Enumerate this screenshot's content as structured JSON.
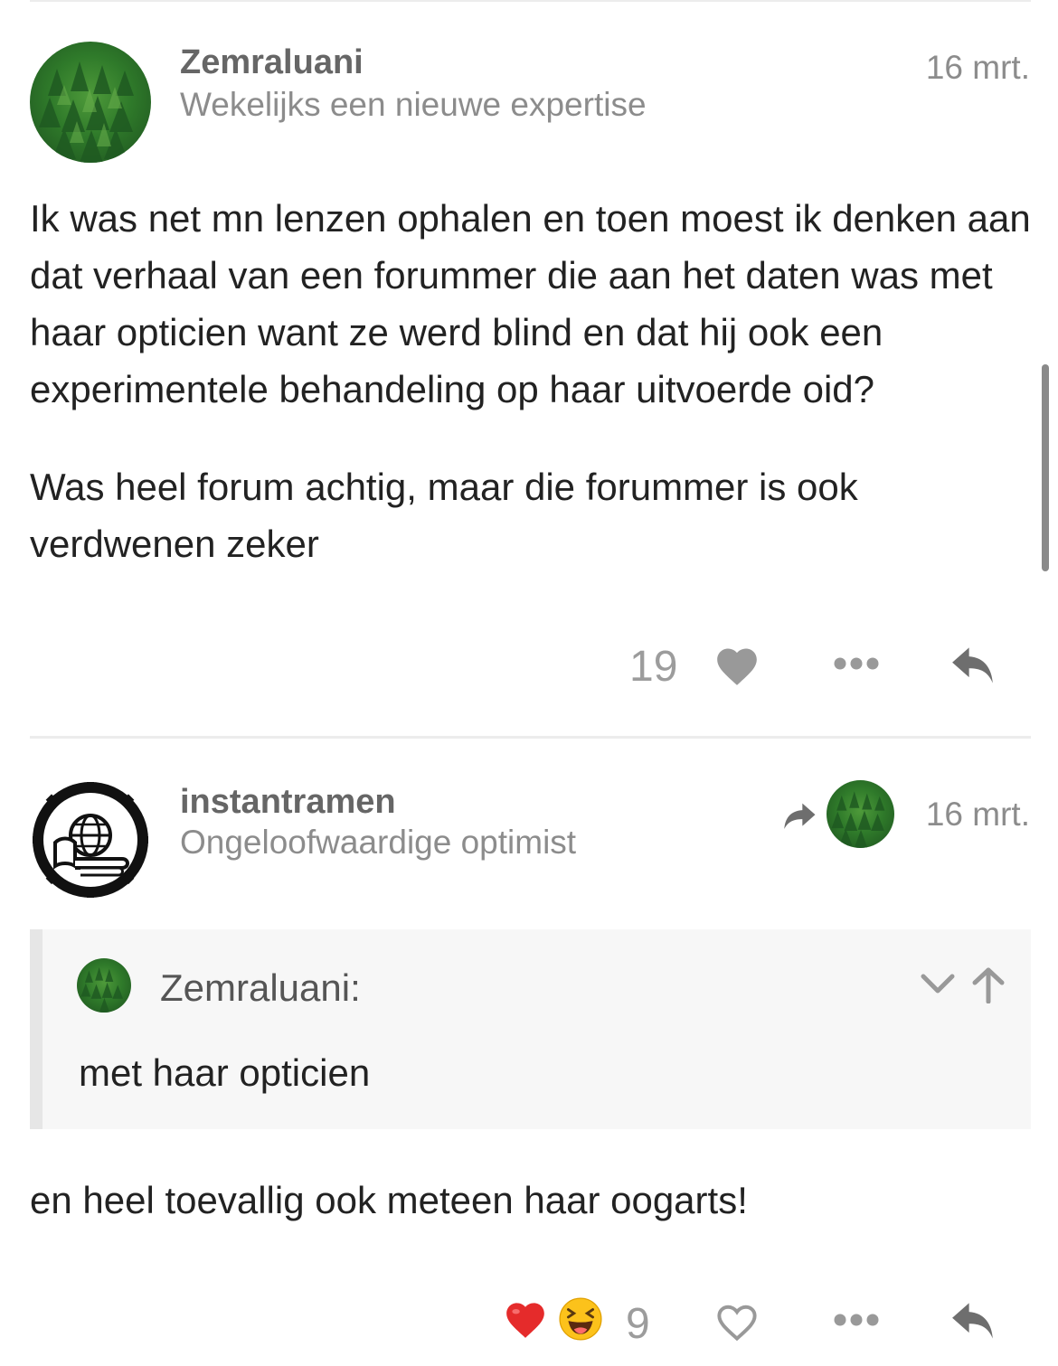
{
  "posts": [
    {
      "username": "Zemraluani",
      "user_title": "Wekelijks een nieuwe expertise",
      "date": "16 mrt.",
      "body": [
        "Ik was net mn lenzen ophalen en toen moest ik denken aan dat verhaal van een forummer die aan het daten was met haar opticien want ze werd blind en dat hij ook een experimentele behandeling op haar uitvoerde oid?",
        "Was heel forum achtig, maar die forummer is ook verdwenen zeker"
      ],
      "like_count": "19",
      "icons": {
        "like": "heart-icon",
        "more": "ellipsis-icon",
        "reply": "reply-icon"
      }
    },
    {
      "username": "instantramen",
      "user_title": "Ongeloofwaardige optimist",
      "date": "16 mrt.",
      "reply_to_icon": "reply-arrow-icon",
      "quote": {
        "username": "Zemraluani:",
        "text": "met haar opticien",
        "icons": {
          "expand": "chevron-down-icon",
          "jump": "arrow-up-icon"
        }
      },
      "body": "en heel toevallig ook meteen haar oogarts!",
      "reactions": [
        "❤️",
        "😆"
      ],
      "reaction_count": "9",
      "icons": {
        "like": "heart-outline-icon",
        "more": "ellipsis-icon",
        "reply": "reply-icon"
      }
    }
  ],
  "colors": {
    "text": "#222222",
    "muted": "#8c8c8c",
    "icon": "#999999",
    "heart_red": "#e52b2b",
    "quote_bg": "#f7f7f7",
    "divider": "#ececec"
  }
}
